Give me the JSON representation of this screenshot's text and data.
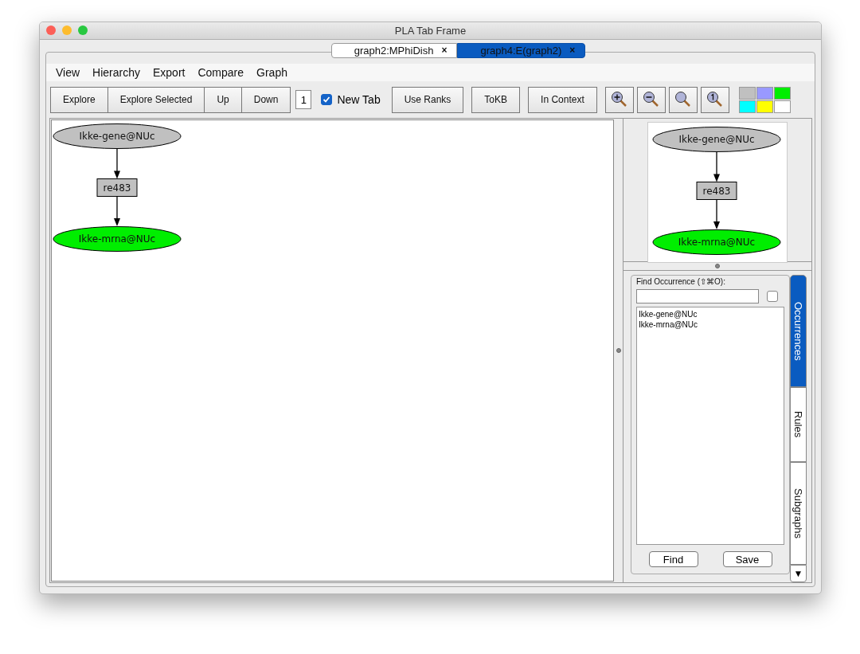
{
  "window": {
    "title": "PLA Tab Frame"
  },
  "tabs": [
    {
      "label": "graph2:MPhiDish",
      "close": "×",
      "selected": false
    },
    {
      "label": "graph4:E(graph2)",
      "close": "×",
      "selected": true
    }
  ],
  "menu": [
    "View",
    "Hierarchy",
    "Export",
    "Compare",
    "Graph"
  ],
  "toolbar": {
    "buttons_left": [
      "Explore",
      "Explore Selected",
      "Up",
      "Down"
    ],
    "depth": "1",
    "new_tab": {
      "label": "New Tab",
      "checked": true
    },
    "buttons_right": [
      "Use Ranks",
      "ToKB",
      "In Context"
    ],
    "zoom_buttons": [
      {
        "kind": "zoom-in"
      },
      {
        "kind": "zoom-out"
      },
      {
        "kind": "zoom-fit"
      },
      {
        "kind": "zoom-actual"
      }
    ],
    "palette": [
      {
        "color": "#c0c0c0"
      },
      {
        "color": "#9999ff"
      },
      {
        "color": "#00ee00"
      },
      {
        "color": "#00ffff"
      },
      {
        "color": "#ffff00"
      },
      {
        "color": "#ffffff"
      }
    ]
  },
  "graph": {
    "nodes": [
      {
        "label": "Ikke-gene@NUc",
        "kind": "ellipse",
        "color": "#c0c0c0"
      },
      {
        "label": "re483",
        "kind": "rect",
        "color": "#c0c0c0"
      },
      {
        "label": "Ikke-mrna@NUc",
        "kind": "ellipse",
        "color": "#00ee00"
      }
    ]
  },
  "overview": {
    "nodes": [
      {
        "label": "Ikke-gene@NUc",
        "kind": "ellipse",
        "color": "#c0c0c0"
      },
      {
        "label": "re483",
        "kind": "rect",
        "color": "#c0c0c0"
      },
      {
        "label": "Ikke-mrna@NUc",
        "kind": "ellipse",
        "color": "#00ee00"
      }
    ]
  },
  "find_panel": {
    "label": "Find Occurrence (⇧⌘O):",
    "option_checked": false,
    "results": [
      "Ikke-gene@NUc",
      "Ikke-mrna@NUc"
    ],
    "buttons": [
      "Find",
      "Save"
    ]
  },
  "side_tabs": [
    {
      "label": "Occurrences",
      "selected": true
    },
    {
      "label": "Rules",
      "selected": false
    },
    {
      "label": "Subgraphs",
      "selected": false
    }
  ],
  "side_tabs_scroll": "▼"
}
